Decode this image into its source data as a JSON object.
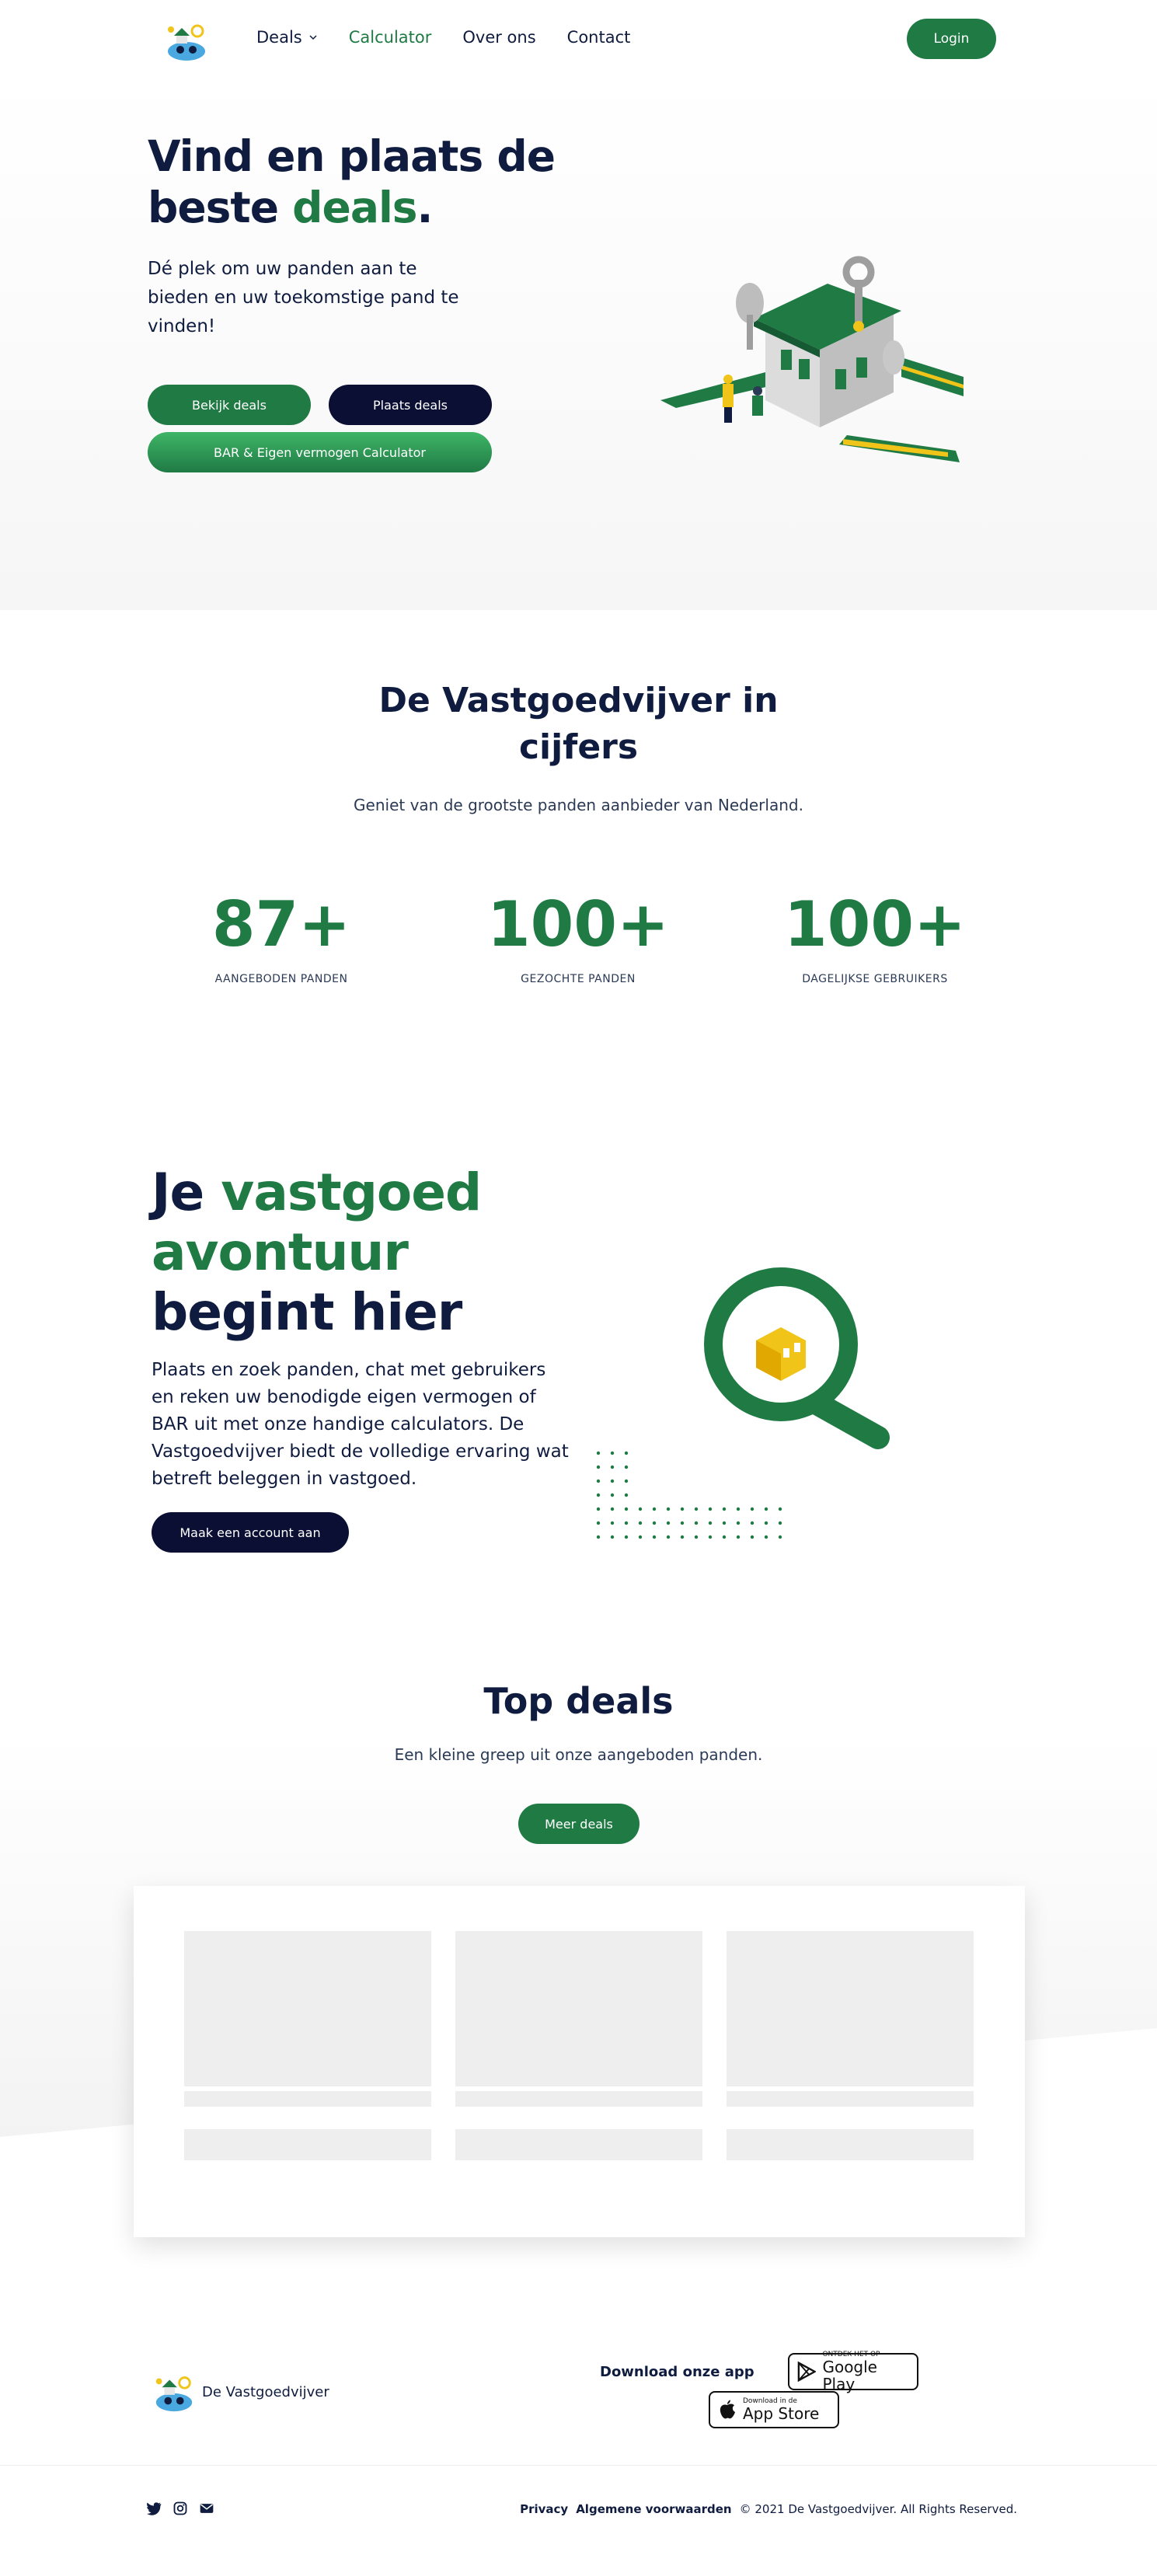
{
  "header": {
    "nav": [
      {
        "label": "Deals",
        "has_dropdown": true
      },
      {
        "label": "Calculator",
        "active": true
      },
      {
        "label": "Over ons"
      },
      {
        "label": "Contact"
      }
    ],
    "login_label": "Login"
  },
  "hero": {
    "title_line1": "Vind en plaats de",
    "title_line2_a": "beste ",
    "title_line2_accent": "deals",
    "title_line2_b": ".",
    "subtitle": "Dé plek om uw panden aan te bieden en uw toekomstige pand te vinden!",
    "buttons": {
      "view_deals": "Bekijk deals",
      "post_deals": "Plaats deals",
      "calculator": "BAR & Eigen vermogen Calculator"
    }
  },
  "stats": {
    "title": "De Vastgoedvijver in cijfers",
    "subtitle": "Geniet van de grootste panden aanbieder van Nederland.",
    "items": [
      {
        "value": "87+",
        "label": "AANGEBODEN PANDEN"
      },
      {
        "value": "100+",
        "label": "GEZOCHTE PANDEN"
      },
      {
        "value": "100+",
        "label": "DAGELIJKSE GEBRUIKERS"
      }
    ]
  },
  "adventure": {
    "title_a": "Je ",
    "title_accent": "vastgoed avontuur",
    "title_b": " begint hier",
    "text": "Plaats en zoek panden, chat met gebruikers en reken uw benodigde eigen vermogen of BAR uit met onze handige calculators. De Vastgoedvijver biedt de volledige ervaring wat betreft beleggen in vastgoed.",
    "cta": "Maak een account aan"
  },
  "deals": {
    "title": "Top deals",
    "subtitle": "Een kleine greep uit onze aangeboden panden.",
    "more_label": "Meer deals"
  },
  "footer": {
    "brand": "De Vastgoedvijver",
    "download_label": "Download onze app",
    "google_small": "ONTDEK HET OP",
    "google_big": "Google Play",
    "apple_small": "Download in de",
    "apple_big": "App Store",
    "privacy": "Privacy",
    "terms": "Algemene voorwaarden",
    "copyright": "© 2021 De Vastgoedvijver. All Rights Reserved."
  },
  "colors": {
    "brand_green": "#1f7a44",
    "navy": "#0f1c3f",
    "button_navy": "#0a0f33"
  }
}
